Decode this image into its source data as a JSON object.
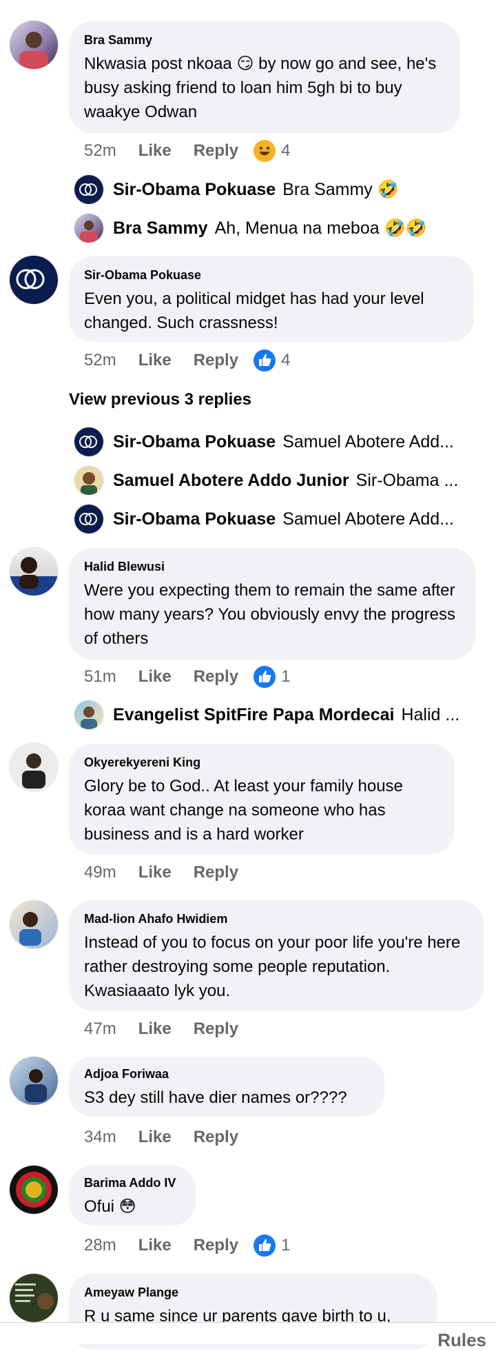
{
  "comments": [
    {
      "author": "Bra Sammy",
      "text": "Nkwasia post nkoaa 😏 by now go and see, he's busy asking friend to loan him 5gh bi to buy waakye Odwan",
      "time": "52m",
      "like": "Like",
      "reply": "Reply",
      "reaction": "laugh-react-icon",
      "reaction_count": "4",
      "replies": [
        {
          "name": "Sir-Obama Pokuase",
          "text": "Bra Sammy 🤣"
        },
        {
          "name": "Bra Sammy",
          "text": "Ah, Menua na meboa 🤣🤣"
        }
      ]
    },
    {
      "author": "Sir-Obama Pokuase",
      "text": "Even you, a political midget has had your level changed. Such crassness!",
      "time": "52m",
      "like": "Like",
      "reply": "Reply",
      "reaction": "thumbs-up-react-icon",
      "reaction_count": "4",
      "view_previous": "View previous 3 replies",
      "replies": [
        {
          "name": "Sir-Obama Pokuase",
          "text": "Samuel Abotere Add..."
        },
        {
          "name": "Samuel Abotere Addo Junior",
          "text": "Sir-Obama ..."
        },
        {
          "name": "Sir-Obama Pokuase",
          "text": "Samuel Abotere Add..."
        }
      ]
    },
    {
      "author": "Halid Blewusi",
      "text": "Were you expecting them to remain the same after how many years? You obviously envy the progress of others",
      "time": "51m",
      "like": "Like",
      "reply": "Reply",
      "reaction": "thumbs-up-react-icon",
      "reaction_count": "1",
      "replies": [
        {
          "name": "Evangelist SpitFire Papa Mordecai",
          "text": "Halid ..."
        }
      ]
    },
    {
      "author": "Okyerekyereni King",
      "text": "Glory be to God.. At least your family house koraa want change na someone who has business and is a hard worker",
      "time": "49m",
      "like": "Like",
      "reply": "Reply"
    },
    {
      "author": "Mad-lion Ahafo Hwidiem",
      "text": "Instead of you to focus on your poor life you're here rather destroying some people reputation. Kwasiaaato lyk you.",
      "time": "47m",
      "like": "Like",
      "reply": "Reply"
    },
    {
      "author": "Adjoa Foriwaa",
      "text": "S3 dey still have dier names or????",
      "time": "34m",
      "like": "Like",
      "reply": "Reply"
    },
    {
      "author": "Barima Addo IV",
      "text": "Ofui 😳",
      "time": "28m",
      "like": "Like",
      "reply": "Reply",
      "reaction": "thumbs-up-react-icon",
      "reaction_count": "1"
    },
    {
      "author": "Ameyaw Plange",
      "text": "R u same since ur parents gave birth to u,"
    }
  ],
  "footer": {
    "rules": "Rules"
  },
  "colors": {
    "bubble": "#f0f2f5",
    "meta": "#65676b",
    "like_blue": "#1877f2",
    "emoji_yellow": "#f7b125"
  }
}
